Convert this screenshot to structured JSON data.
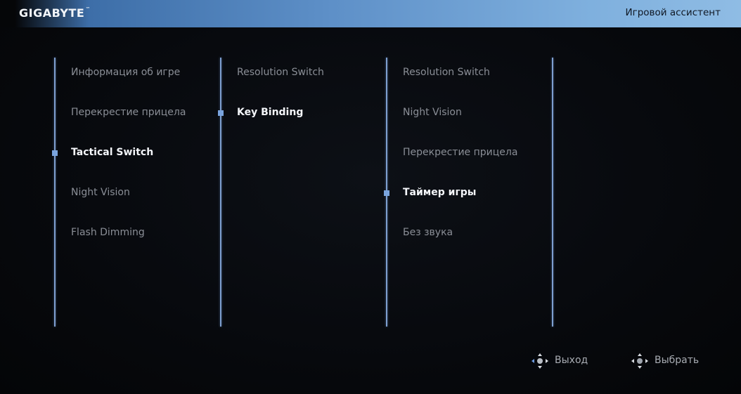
{
  "header": {
    "brand": "GIGABYTE",
    "brand_mark": "™",
    "title": "Игровой ассистент",
    "accent_color": "#6f9fd6"
  },
  "menu": {
    "level1": {
      "items": [
        {
          "label": "Информация об игре"
        },
        {
          "label": "Перекрестие прицела"
        },
        {
          "label": "Tactical Switch",
          "selected": true
        },
        {
          "label": "Night Vision"
        },
        {
          "label": "Flash Dimming"
        }
      ]
    },
    "level2": {
      "items": [
        {
          "label": "Resolution Switch"
        },
        {
          "label": "Key Binding",
          "selected": true
        }
      ]
    },
    "level3": {
      "items": [
        {
          "label": "Resolution Switch"
        },
        {
          "label": "Night Vision"
        },
        {
          "label": "Перекрестие прицела"
        },
        {
          "label": "Таймер игры",
          "selected": true
        },
        {
          "label": "Без звука"
        }
      ]
    },
    "level4": {
      "items": []
    }
  },
  "footer": {
    "exit": {
      "label": "Выход",
      "icon": "joystick-left-icon"
    },
    "select": {
      "label": "Выбрать",
      "icon": "joystick-press-icon"
    }
  },
  "colors": {
    "selected_marker": "#7aa4de",
    "divider": "#7e9fd0",
    "item_text": "#8a8e96",
    "selected_text": "#f4f6fa"
  }
}
